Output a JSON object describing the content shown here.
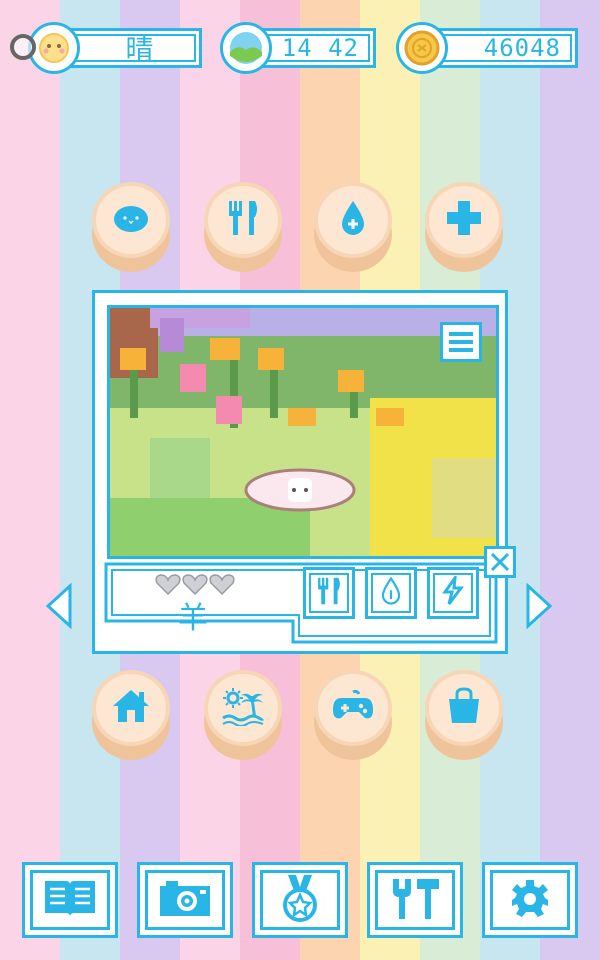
{
  "stripes": [
    "#fcd4e8",
    "#c8e6ef",
    "#d9c8f0",
    "#fcd4e8",
    "#f8bfd9",
    "#fdd4b0",
    "#fbf1b4",
    "#d8ecd6",
    "#c8e6ef",
    "#d9c8f0"
  ],
  "colors": {
    "accent": "#29b6e6",
    "button_face": "#fde7d2",
    "button_base": "#f0c49a"
  },
  "status": {
    "weather": {
      "icon": "sun-face-icon",
      "label": "晴"
    },
    "time": {
      "icon": "landscape-icon",
      "label": "14 42"
    },
    "coins": {
      "icon": "coin-icon",
      "label": "46048"
    }
  },
  "top_actions": [
    {
      "name": "pet-button",
      "icon": "slime-icon"
    },
    {
      "name": "feed-button",
      "icon": "fork-knife-icon"
    },
    {
      "name": "water-button",
      "icon": "water-drop-icon"
    },
    {
      "name": "heal-button",
      "icon": "plus-icon"
    }
  ],
  "pet": {
    "name": "羊",
    "hearts_filled": 3,
    "hearts_total": 3,
    "stats": [
      {
        "name": "hunger-stat",
        "icon": "fork-knife-icon"
      },
      {
        "name": "thirst-stat",
        "icon": "water-drop-icon"
      },
      {
        "name": "energy-stat",
        "icon": "lightning-icon"
      }
    ]
  },
  "bottom_actions": [
    {
      "name": "home-button",
      "icon": "house-icon"
    },
    {
      "name": "outing-button",
      "icon": "beach-icon"
    },
    {
      "name": "game-button",
      "icon": "gamepad-icon"
    },
    {
      "name": "shop-button",
      "icon": "shopping-bag-icon"
    }
  ],
  "toolbar": [
    {
      "name": "book-button",
      "icon": "book-icon"
    },
    {
      "name": "camera-button",
      "icon": "camera-icon"
    },
    {
      "name": "medal-button",
      "icon": "medal-icon"
    },
    {
      "name": "tools-button",
      "icon": "tools-icon"
    },
    {
      "name": "settings-button",
      "icon": "gear-icon"
    }
  ]
}
